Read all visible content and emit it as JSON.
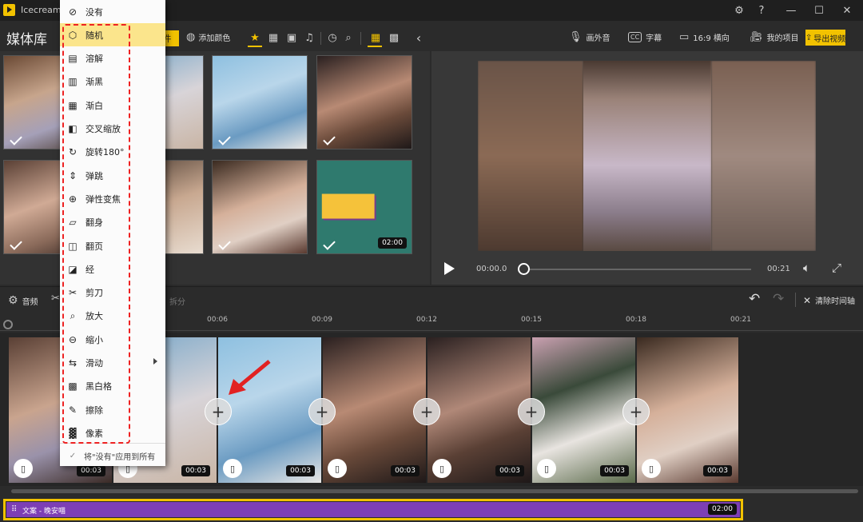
{
  "window": {
    "title": "Icecream Vi",
    "title_suffix": "1"
  },
  "media_library": {
    "title": "媒体库",
    "import_label": "件",
    "add_color_label": "添加颜色"
  },
  "media_thumbs": [
    {
      "selected": true,
      "duration": ""
    },
    {
      "selected": false,
      "duration": ""
    },
    {
      "selected": true,
      "duration": ""
    },
    {
      "selected": true,
      "duration": ""
    },
    {
      "selected": true,
      "duration": ""
    },
    {
      "selected": false,
      "duration": ""
    },
    {
      "selected": true,
      "duration": ""
    },
    {
      "selected": true,
      "duration": "02:00"
    }
  ],
  "right_toolbar": {
    "voiceover": "画外音",
    "subtitles": "字幕",
    "aspect": "16:9 横向",
    "projects": "我的项目",
    "export": "导出视频"
  },
  "player": {
    "current_time": "00:00.0",
    "total_time": "00:21",
    "progress": 0
  },
  "timeline_toolbar": {
    "audio": "音频",
    "split": "拆分",
    "clear": "清除时间轴"
  },
  "ruler_ticks": [
    "00:06",
    "00:09",
    "00:12",
    "00:15",
    "00:18",
    "00:21"
  ],
  "clips": [
    {
      "duration": "00:03"
    },
    {
      "duration": "00:03"
    },
    {
      "duration": "00:03"
    },
    {
      "duration": "00:03"
    },
    {
      "duration": "00:03"
    },
    {
      "duration": "00:03"
    },
    {
      "duration": "00:03"
    }
  ],
  "audio_track": {
    "label": "文案 - 晚安喵",
    "duration": "02:00"
  },
  "transition_menu": {
    "items": [
      {
        "label": "没有",
        "icon": "none-icon"
      },
      {
        "label": "随机",
        "icon": "random-cube-icon"
      },
      {
        "label": "溶解",
        "icon": "dissolve-icon"
      },
      {
        "label": "渐黑",
        "icon": "fade-black-icon"
      },
      {
        "label": "渐白",
        "icon": "fade-white-icon"
      },
      {
        "label": "交叉缩放",
        "icon": "cross-zoom-icon"
      },
      {
        "label": "旋转180°",
        "icon": "rotate-180-icon"
      },
      {
        "label": "弹跳",
        "icon": "bounce-icon"
      },
      {
        "label": "弹性变焦",
        "icon": "elastic-zoom-icon"
      },
      {
        "label": "翻身",
        "icon": "flip-icon"
      },
      {
        "label": "翻页",
        "icon": "page-turn-icon"
      },
      {
        "label": "经",
        "icon": "warp-icon"
      },
      {
        "label": "剪刀",
        "icon": "scissors-icon"
      },
      {
        "label": "放大",
        "icon": "zoom-in-icon"
      },
      {
        "label": "缩小",
        "icon": "zoom-out-icon"
      },
      {
        "label": "滑动",
        "icon": "slide-icon"
      },
      {
        "label": "黑白格",
        "icon": "checkerboard-icon"
      },
      {
        "label": "擦除",
        "icon": "wipe-icon"
      },
      {
        "label": "像素",
        "icon": "pixel-icon"
      }
    ],
    "apply_all": "将\"没有\"应用到所有",
    "highlighted_index": 1
  },
  "colors": {
    "accent": "#f2c200",
    "audio_clip": "#7d3fb5",
    "annotation": "#e22222"
  }
}
